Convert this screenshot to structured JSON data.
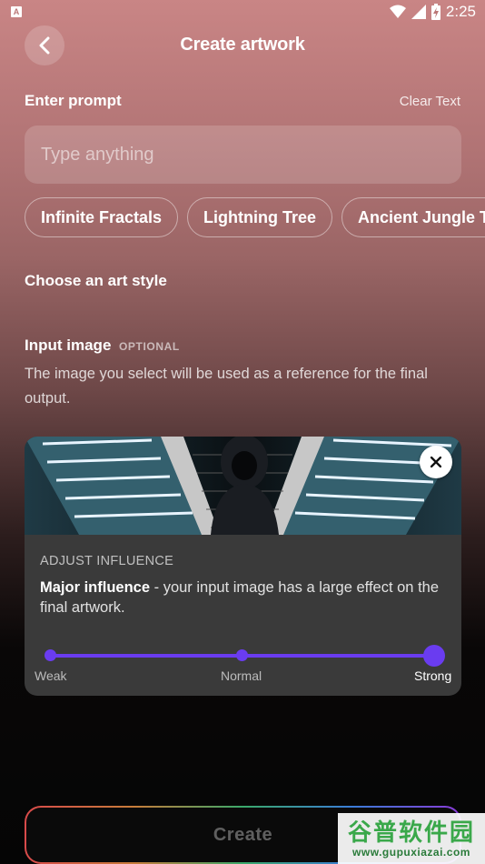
{
  "status_bar": {
    "time": "2:25",
    "left_icon": "app-notification-icon"
  },
  "header": {
    "title": "Create artwork",
    "back_icon": "chevron-left-icon"
  },
  "prompt": {
    "label": "Enter prompt",
    "clear_label": "Clear Text",
    "placeholder": "Type anything",
    "value": "",
    "suggestions": [
      "Infinite Fractals",
      "Lightning Tree",
      "Ancient Jungle T"
    ]
  },
  "art_style": {
    "label": "Choose an art style"
  },
  "input_image": {
    "label": "Input image",
    "optional_tag": "OPTIONAL",
    "description": "The image you select will be used as a reference for the final output.",
    "remove_icon": "close-icon"
  },
  "influence": {
    "title": "ADJUST INFLUENCE",
    "level_name": "Major influence",
    "level_desc": " - your input image has a large effect on the final artwork.",
    "options": [
      "Weak",
      "Normal",
      "Strong"
    ],
    "selected": "Strong",
    "selected_fraction": 1.0
  },
  "create_button": {
    "label": "Create"
  },
  "watermark": {
    "brand": "谷普软件园",
    "url": "www.gupuxiazai.com"
  },
  "colors": {
    "accent": "#6a3cf0",
    "bg_top": "#c98585",
    "bg_bottom": "#050505"
  }
}
